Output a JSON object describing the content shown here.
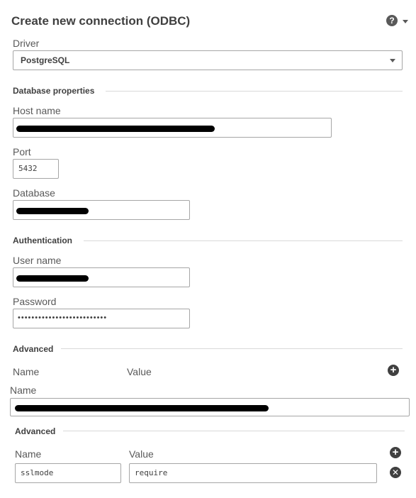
{
  "dialog": {
    "title": "Create new connection (ODBC)",
    "help_icon": "help-icon",
    "help_glyph": "?"
  },
  "driver": {
    "label": "Driver",
    "selected": "PostgreSQL"
  },
  "database_properties": {
    "heading": "Database properties",
    "host_label": "Host name",
    "host_value": "",
    "port_label": "Port",
    "port_value": "5432",
    "database_label": "Database",
    "database_value": ""
  },
  "authentication": {
    "heading": "Authentication",
    "username_label": "User name",
    "username_value": "",
    "password_label": "Password",
    "password_value": "••••••••••••••••••••••••••"
  },
  "advanced": {
    "heading": "Advanced",
    "name_col": "Name",
    "value_col": "Value",
    "add_icon": "plus-circle-icon",
    "add_glyph": "+",
    "name_label": "Name",
    "name_value": ""
  },
  "advanced_nested": {
    "heading": "Advanced",
    "name_col": "Name",
    "value_col": "Value",
    "add_icon": "plus-circle-icon",
    "add_glyph": "+",
    "row": {
      "name": "sslmode",
      "value": "require",
      "remove_icon": "close-circle-icon",
      "remove_glyph": "✕"
    }
  }
}
